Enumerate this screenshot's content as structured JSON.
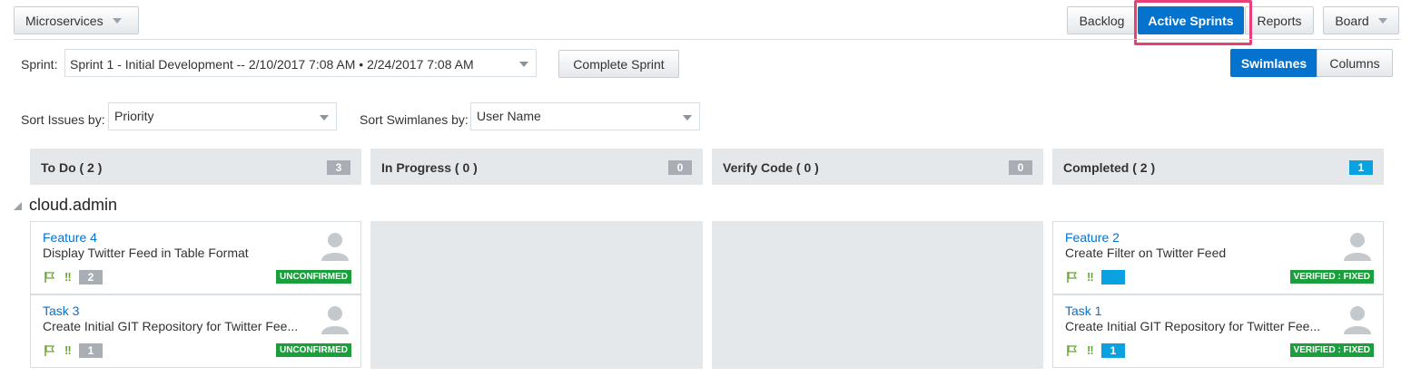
{
  "project_select": {
    "label": "Microservices"
  },
  "view_tabs": [
    {
      "label": "Backlog",
      "active": false
    },
    {
      "label": "Active Sprints",
      "active": true
    },
    {
      "label": "Reports",
      "active": false
    }
  ],
  "board_menu": {
    "label": "Board"
  },
  "sprint": {
    "label": "Sprint:",
    "value": "Sprint 1 - Initial Development -- 2/10/2017 7:08 AM • 2/24/2017 7:08 AM",
    "complete_label": "Complete Sprint"
  },
  "layout_toggle": {
    "swimlanes": "Swimlanes",
    "columns": "Columns",
    "active": "Swimlanes"
  },
  "sort_issues": {
    "label": "Sort Issues by:",
    "value": "Priority"
  },
  "sort_swimlanes": {
    "label": "Sort Swimlanes by:",
    "value": "User Name"
  },
  "columns": [
    {
      "title": "To Do ( 2 )",
      "count": "3",
      "count_color": "#a8aeb4"
    },
    {
      "title": "In Progress ( 0 )",
      "count": "0",
      "count_color": "#a8aeb4"
    },
    {
      "title": "Verify Code ( 0 )",
      "count": "0",
      "count_color": "#a8aeb4"
    },
    {
      "title": "Completed ( 2 )",
      "count": "1",
      "count_color": "#0aa1e0"
    }
  ],
  "swimlane": {
    "name": "cloud.admin",
    "cards": {
      "todo": [
        {
          "id": "Feature 4",
          "summary": "Display Twitter Feed in Table Format",
          "points": "2",
          "status": "UNCONFIRMED"
        },
        {
          "id": "Task 3",
          "summary": "Create Initial GIT Repository for Twitter Fee...",
          "points": "1",
          "status": "UNCONFIRMED"
        }
      ],
      "completed": [
        {
          "id": "Feature 2",
          "summary": "Create Filter on Twitter Feed",
          "points": "",
          "status": "VERIFIED : FIXED"
        },
        {
          "id": "Task 1",
          "summary": "Create Initial GIT Repository for Twitter Fee...",
          "points": "1",
          "status": "VERIFIED : FIXED"
        }
      ]
    }
  },
  "icons": {
    "flag": "flag-icon",
    "priority": "priority-icon",
    "avatar": "user-avatar-icon",
    "dropdown": "chevron-down-icon",
    "collapse": "collapse-triangle-icon"
  },
  "colors": {
    "accent": "#0572ce",
    "status_green": "#1a9f3c",
    "points_blue": "#0aa1e0",
    "highlight": "#e83e7b"
  }
}
